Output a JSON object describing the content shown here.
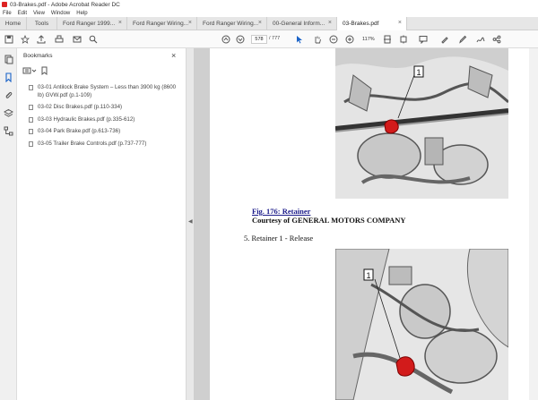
{
  "window": {
    "title": "03-Brakes.pdf - Adobe Acrobat Reader DC"
  },
  "menu": [
    "File",
    "Edit",
    "View",
    "Window",
    "Help"
  ],
  "tabs": {
    "home": "Home",
    "tools": "Tools",
    "docs": [
      {
        "label": "Ford Ranger 1999..."
      },
      {
        "label": "Ford Ranger Wiring..."
      },
      {
        "label": "Ford Ranger Wiring..."
      },
      {
        "label": "00-General Inform..."
      },
      {
        "label": "03-Brakes.pdf"
      }
    ]
  },
  "toolbar": {
    "page_current": "578",
    "page_total": "/ 777",
    "zoom": "117%"
  },
  "bookmarks": {
    "title": "Bookmarks",
    "items": [
      "03-01 Antilock Brake System – Less than 3900 kg (8600 lb) GVW.pdf (p.1-109)",
      "03-02 Disc Brakes.pdf (p.110-334)",
      "03-03 Hydraulic Brakes.pdf (p.335-612)",
      "03-04 Park Brake.pdf (p.613-736)",
      "03-05 Trailer Brake Controls.pdf (p.737-777)"
    ]
  },
  "document": {
    "fig_title": "Fig. 176: Retainer",
    "fig_credit": "Courtesy of GENERAL MOTORS COMPANY",
    "step": "5. Retainer 1 - Release",
    "callout_top": "1",
    "callout_bottom": "1"
  }
}
